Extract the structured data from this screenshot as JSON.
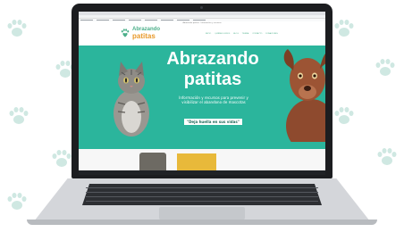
{
  "site": {
    "top_note": "Abrazando patitas · Información y recursos",
    "logo": {
      "line1": "Abrazando",
      "line2": "patitas"
    },
    "nav": [
      "INICIO",
      "QUIÉNES SOMOS",
      "BLOG",
      "TIENDA",
      "CONTACTO",
      "DONACIONES"
    ]
  },
  "hero": {
    "title_line1": "Abrazando",
    "title_line2": "patitas",
    "subtitle": "Información y recursos para prevenir y visibilizar el abandono de mascotas",
    "quote": "\"Deja huella en sus vidas\""
  },
  "colors": {
    "hero_bg": "#2bb59c",
    "brand_green": "#4caf8a",
    "brand_orange": "#e89a2c",
    "paw_print": "#cfe8e2"
  },
  "icons": [
    "paw-print-icon",
    "logo-paw-icon",
    "cat-photo",
    "dog-photo",
    "laptop"
  ]
}
